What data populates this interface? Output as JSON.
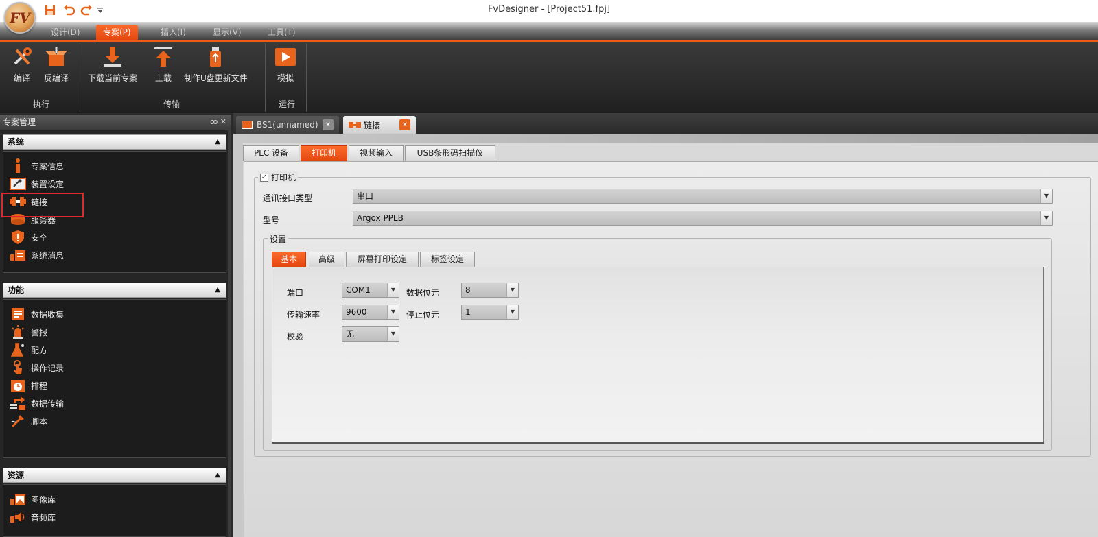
{
  "app": {
    "logo_text": "FV",
    "window_title": "FvDesigner - [Project51.fpj]"
  },
  "ribbon_tabs": [
    "设计(D)",
    "专案(P)",
    "插入(I)",
    "显示(V)",
    "工具(T)"
  ],
  "ribbon_buttons": {
    "compile": "编译",
    "decompile": "反编译",
    "download": "下载当前专案",
    "upload": "上载",
    "usb_update": "制作U盘更新文件",
    "simulate": "模拟"
  },
  "ribbon_groups": {
    "execute": "执行",
    "transfer": "传输",
    "run": "运行"
  },
  "left_panel": {
    "title": "专案管理",
    "controls": "ꝏ ✕",
    "sections": [
      {
        "title": "系统",
        "items": [
          "专案信息",
          "装置设定",
          "链接",
          "服务器",
          "安全",
          "系统消息"
        ]
      },
      {
        "title": "功能",
        "items": [
          "数据收集",
          "警报",
          "配方",
          "操作记录",
          "排程",
          "数据传输",
          "脚本"
        ]
      },
      {
        "title": "资源",
        "items": [
          "图像库",
          "音频库"
        ]
      }
    ]
  },
  "doc_tabs": {
    "bs1": "BS1(unnamed)",
    "link": "链接"
  },
  "sub_tabs": [
    "PLC 设备",
    "打印机",
    "视频输入",
    "USB条形码扫描仪"
  ],
  "printer": {
    "enable_label": "打印机",
    "enabled": true,
    "interface_label": "通讯接口类型",
    "interface_value": "串口",
    "model_label": "型号",
    "model_value": "Argox PPLB",
    "settings_label": "设置"
  },
  "settings_tabs": [
    "基本",
    "高级",
    "屏幕打印设定",
    "标签设定"
  ],
  "basic": {
    "port_label": "端口",
    "port_value": "COM1",
    "data_bits_label": "数据位元",
    "data_bits_value": "8",
    "baud_label": "传输速率",
    "baud_value": "9600",
    "stop_bits_label": "停止位元",
    "stop_bits_value": "1",
    "parity_label": "校验",
    "parity_value": "无"
  },
  "colors": {
    "accent": "#f05a1a",
    "highlight": "#e0282e",
    "dark_bg": "#262626"
  }
}
